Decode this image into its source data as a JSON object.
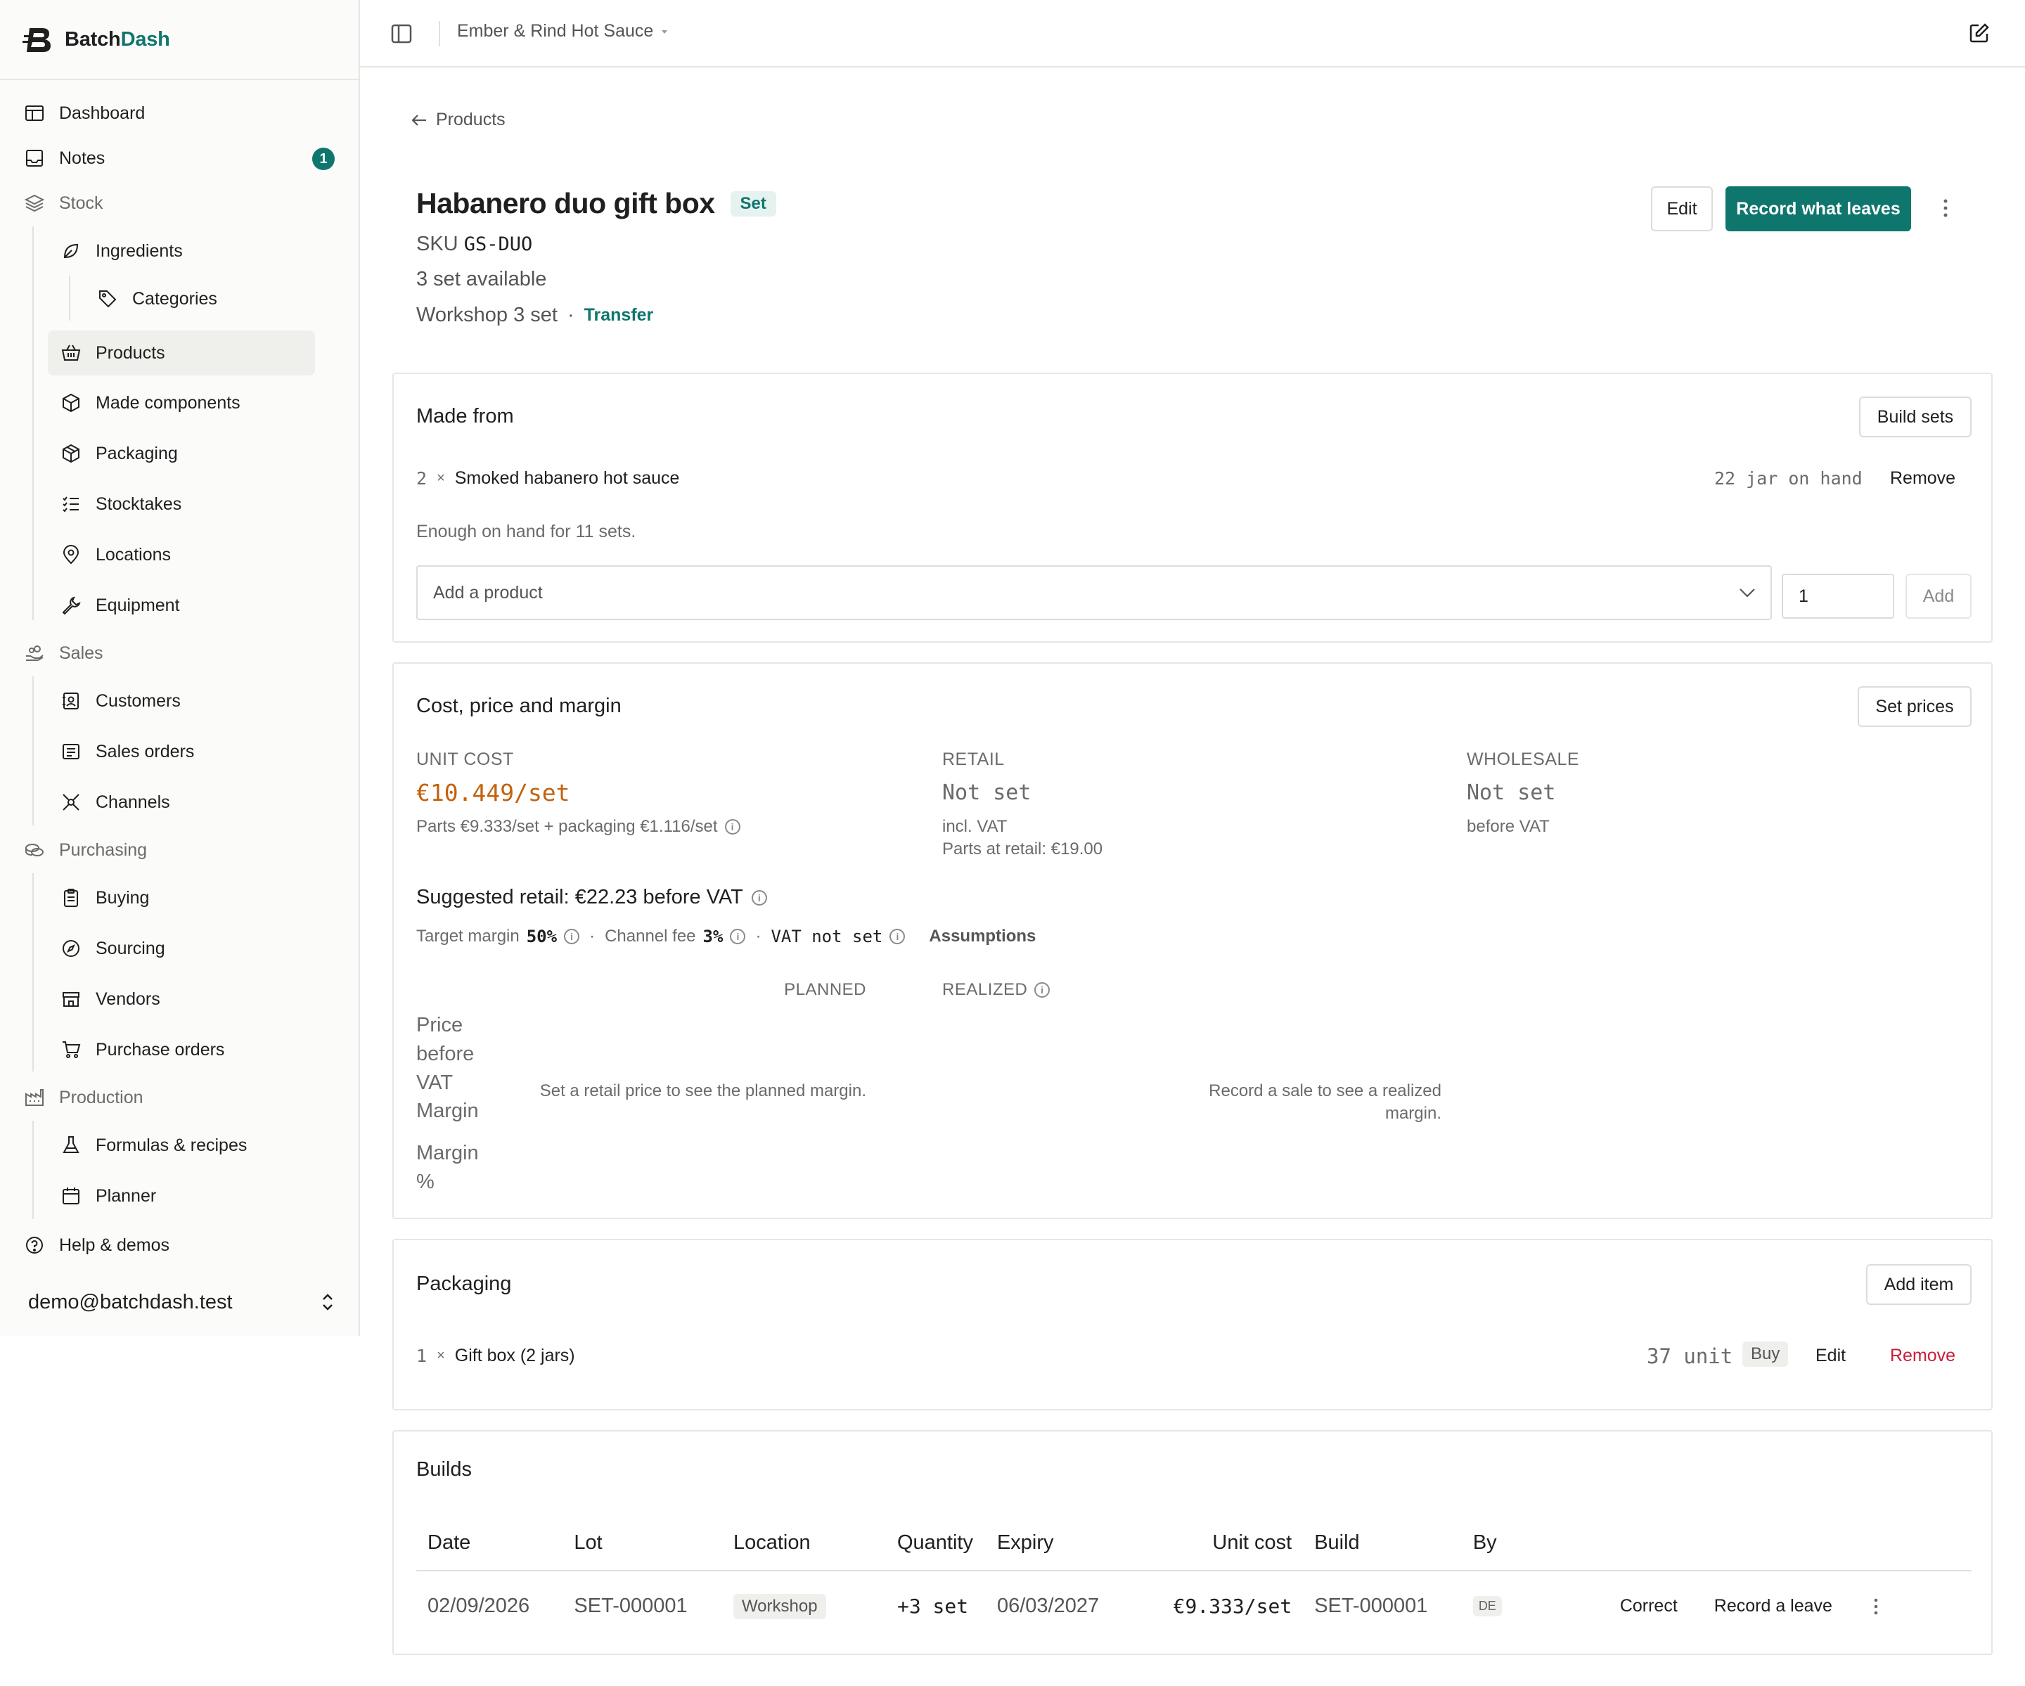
{
  "app": {
    "name_part1": "Batch",
    "name_part2": "Dash"
  },
  "workspace": "Ember & Rind Hot Sauce",
  "sidebar": {
    "dashboard": "Dashboard",
    "notes": "Notes",
    "notes_badge": "1",
    "stock": "Stock",
    "ingredients": "Ingredients",
    "categories": "Categories",
    "products": "Products",
    "made_components": "Made components",
    "packaging": "Packaging",
    "stocktakes": "Stocktakes",
    "locations": "Locations",
    "equipment": "Equipment",
    "sales": "Sales",
    "customers": "Customers",
    "sales_orders": "Sales orders",
    "channels": "Channels",
    "purchasing": "Purchasing",
    "buying": "Buying",
    "sourcing": "Sourcing",
    "vendors": "Vendors",
    "purchase_orders": "Purchase orders",
    "production": "Production",
    "formulas": "Formulas & recipes",
    "planner": "Planner",
    "help": "Help & demos",
    "user": "demo@batchdash.test"
  },
  "back_link": "Products",
  "product": {
    "title": "Habanero duo gift box",
    "tag": "Set",
    "sku_label": "SKU",
    "sku": "GS-DUO",
    "available": "3 set available",
    "location_line": "Workshop 3 set",
    "dot": "·",
    "transfer": "Transfer"
  },
  "actions": {
    "edit": "Edit",
    "record": "Record what leaves"
  },
  "made_from": {
    "title": "Made from",
    "build_sets": "Build sets",
    "item_qty": "2",
    "times": "×",
    "item_name": "Smoked habanero hot sauce",
    "on_hand": "22 jar on hand",
    "remove": "Remove",
    "enough": "Enough on hand for 11 sets.",
    "add_placeholder": "Add a product",
    "qty_value": "1",
    "add": "Add"
  },
  "cost": {
    "title": "Cost, price and margin",
    "set_prices": "Set prices",
    "unit_cost_label": "UNIT COST",
    "unit_cost_value": "€10.449/set",
    "unit_cost_sub": "Parts €9.333/set + packaging €1.116/set",
    "retail_label": "RETAIL",
    "retail_value": "Not set",
    "retail_sub1": "incl. VAT",
    "retail_sub2": "Parts at retail: €19.00",
    "wholesale_label": "WHOLESALE",
    "wholesale_value": "Not set",
    "wholesale_sub": "before VAT",
    "suggested": "Suggested retail: €22.23 before VAT",
    "target_margin_label": "Target margin",
    "target_margin_value": "50%",
    "channel_fee_label": "Channel fee",
    "channel_fee_value": "3%",
    "vat": "VAT not set",
    "assumptions": "Assumptions",
    "planned": "PLANNED",
    "realized": "REALIZED",
    "row_price": "Price before VAT",
    "row_margin": "Margin",
    "row_margin_pct": "Margin %",
    "planned_empty": "Set a retail price to see the planned margin.",
    "realized_empty": "Record a sale to see a realized margin."
  },
  "packaging": {
    "title": "Packaging",
    "add_item": "Add item",
    "qty": "1",
    "times": "×",
    "name": "Gift box (2 jars)",
    "stock": "37 unit",
    "buy": "Buy",
    "edit": "Edit",
    "remove": "Remove"
  },
  "builds": {
    "title": "Builds",
    "headers": [
      "Date",
      "Lot",
      "Location",
      "Quantity",
      "Expiry",
      "Unit cost",
      "Build",
      "By"
    ],
    "row": {
      "date": "02/09/2026",
      "lot": "SET-000001",
      "location": "Workshop",
      "quantity": "+3 set",
      "expiry": "06/03/2027",
      "unit_cost": "€9.333/set",
      "build": "SET-000001",
      "by": "DE",
      "correct": "Correct",
      "record_leave": "Record a leave"
    }
  },
  "colors": {
    "accent": "#0f766e",
    "cost": "#c2620e",
    "danger": "#c81e3a"
  }
}
